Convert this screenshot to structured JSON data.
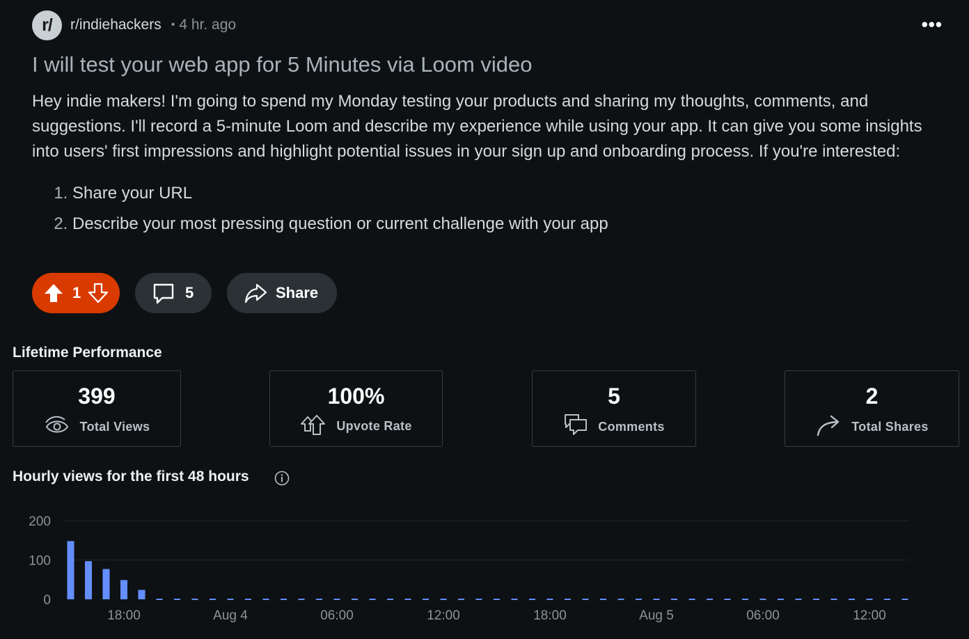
{
  "post": {
    "subreddit_avatar": "r/",
    "subreddit": "r/indiehackers",
    "separator": "•",
    "age": "4 hr. ago",
    "more": "•••",
    "title": "I will test your web app for 5 Minutes via Loom video",
    "body": "Hey indie makers! I'm going to spend my Monday testing your products and sharing my thoughts, comments, and suggestions. I'll record a 5-minute Loom and describe my experience while using your app. It can give you some insights into users' first impressions and highlight potential issues in your sign up and onboarding process. If you're interested:",
    "steps": [
      "Share your URL",
      "Describe your most pressing question or current challenge with your app"
    ]
  },
  "actions": {
    "vote_count": "1",
    "comment_count": "5",
    "share_label": "Share"
  },
  "performance": {
    "title": "Lifetime Performance",
    "stats": [
      {
        "value": "399",
        "label": "Total Views",
        "icon": "eye-icon"
      },
      {
        "value": "100%",
        "label": "Upvote Rate",
        "icon": "upvote-icon"
      },
      {
        "value": "5",
        "label": "Comments",
        "icon": "comments-icon"
      },
      {
        "value": "2",
        "label": "Total Shares",
        "icon": "share-arrow-icon"
      }
    ]
  },
  "chart_section": {
    "title": "Hourly views for the first 48 hours",
    "info_icon": "info-icon"
  },
  "colors": {
    "background": "#0e1113",
    "upvote_accent": "#d93a00",
    "bar": "#648efc"
  },
  "chart_data": {
    "type": "bar",
    "x": [
      "15:00",
      "16:00",
      "17:00",
      "18:00",
      "19:00",
      "20:00",
      "21:00",
      "22:00",
      "23:00",
      "Aug 4 00:00",
      "01:00",
      "02:00",
      "03:00",
      "04:00",
      "05:00",
      "06:00",
      "07:00",
      "08:00",
      "09:00",
      "10:00",
      "11:00",
      "12:00",
      "13:00",
      "14:00",
      "15:00",
      "16:00",
      "17:00",
      "18:00",
      "19:00",
      "20:00",
      "21:00",
      "22:00",
      "23:00",
      "Aug 5 00:00",
      "01:00",
      "02:00",
      "03:00",
      "04:00",
      "05:00",
      "06:00",
      "07:00",
      "08:00",
      "09:00",
      "10:00",
      "11:00",
      "12:00",
      "13:00",
      "14:00"
    ],
    "values": [
      148,
      97,
      77,
      49,
      24,
      null,
      null,
      null,
      null,
      null,
      null,
      null,
      null,
      null,
      null,
      null,
      null,
      null,
      null,
      null,
      null,
      null,
      null,
      null,
      null,
      null,
      null,
      null,
      null,
      null,
      null,
      null,
      null,
      null,
      null,
      null,
      null,
      null,
      null,
      null,
      null,
      null,
      null,
      null,
      null,
      null,
      null,
      null
    ],
    "x_tick_labels": [
      "18:00",
      "Aug 4",
      "06:00",
      "12:00",
      "18:00",
      "Aug 5",
      "06:00",
      "12:00"
    ],
    "y_tick_labels": [
      "200",
      "100",
      "0"
    ],
    "ylim": [
      0,
      200
    ],
    "grid": true,
    "legend": "none"
  }
}
